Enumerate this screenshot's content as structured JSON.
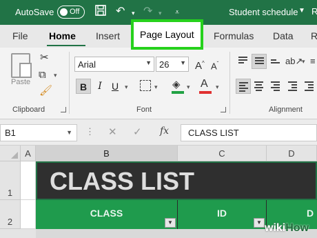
{
  "titlebar": {
    "autosave_label": "AutoSave",
    "autosave_state": "Off",
    "document_title": "Student schedule",
    "title_cut": "R"
  },
  "tabs": [
    {
      "label": "File"
    },
    {
      "label": "Home"
    },
    {
      "label": "Insert"
    },
    {
      "label": "Page Layout"
    },
    {
      "label": "Formulas"
    },
    {
      "label": "Data"
    },
    {
      "label": "R"
    }
  ],
  "ribbon": {
    "clipboard": {
      "paste_label": "Paste",
      "group_label": "Clipboard"
    },
    "font": {
      "font_name": "Arial",
      "font_size": "26",
      "bold": "B",
      "italic": "I",
      "underline": "U",
      "group_label": "Font",
      "fill_color": "#21a144",
      "font_color": "#e03030"
    },
    "alignment": {
      "group_label": "Alignment"
    }
  },
  "formula_bar": {
    "name_box": "B1",
    "fx": "fx",
    "content": "CLASS LIST"
  },
  "grid": {
    "columns": [
      "A",
      "B",
      "C",
      "D"
    ],
    "rows": [
      "1",
      "2"
    ],
    "title_cell": "CLASS LIST",
    "headers": [
      "CLASS",
      "ID",
      "D"
    ]
  },
  "watermark": {
    "wiki": "wiki",
    "how": "How"
  },
  "colors": {
    "accent": "#217346",
    "highlight": "#26d11c",
    "header_green": "#1f9b4d"
  }
}
